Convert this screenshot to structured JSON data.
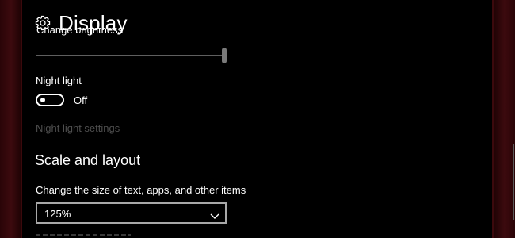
{
  "header": {
    "title": "Display",
    "icon": "gear-icon"
  },
  "brightness": {
    "label": "Change brightness",
    "level_percent": 100
  },
  "night_light": {
    "label": "Night light",
    "toggle_state": "Off",
    "settings_link": "Night light settings"
  },
  "scale_layout": {
    "section_title": "Scale and layout",
    "field_label": "Change the size of text, apps, and other items",
    "selected_value": "125%"
  },
  "colors": {
    "background": "#000000",
    "text": "#ffffff",
    "disabled_text": "#4e4e4e",
    "frame": "#3c0a0e"
  }
}
